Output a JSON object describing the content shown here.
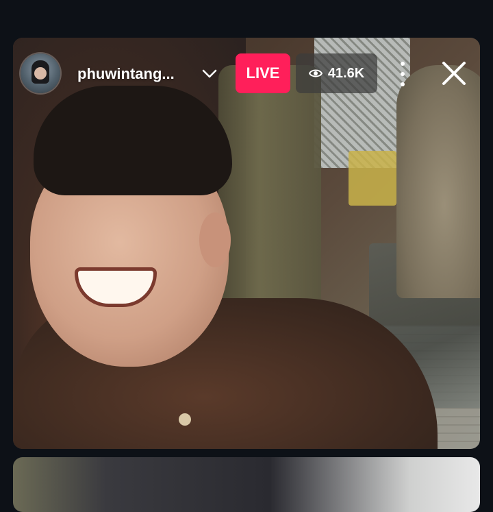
{
  "stream": {
    "username": "phuwintang...",
    "live_label": "LIVE",
    "viewer_count": "41.6K"
  },
  "icons": {
    "avatar": "avatar",
    "dropdown": "chevron-down-icon",
    "viewers": "eye-icon",
    "menu": "more-vertical-icon",
    "close": "close-icon"
  },
  "colors": {
    "background": "#0d1117",
    "live_badge": "#ff1f5a",
    "viewer_badge": "#3c3c3c",
    "text": "#ffffff"
  }
}
